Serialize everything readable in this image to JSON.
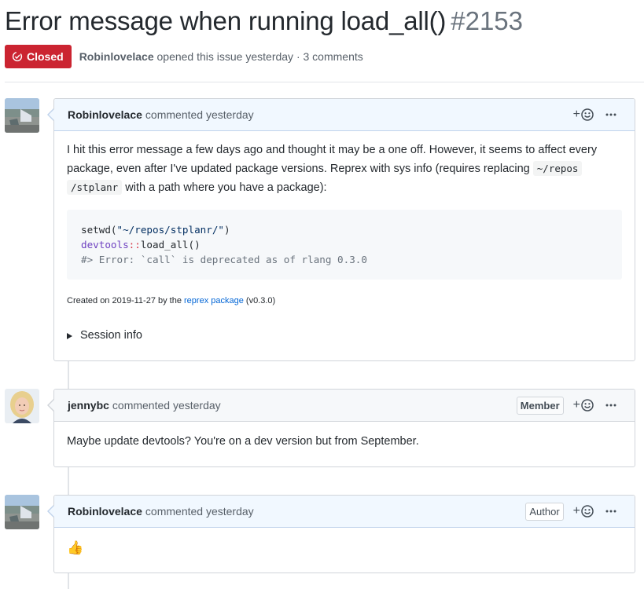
{
  "issue": {
    "title": "Error message when running load_all()",
    "number": "#2153",
    "state": "Closed",
    "opener": "Robinlovelace",
    "opened_text": "opened this issue yesterday · 3 comments"
  },
  "comments": [
    {
      "author": "Robinlovelace",
      "when": "commented yesterday",
      "role": "",
      "body_text_1": "I hit this error message a few days ago and thought it may be a one off. However, it seems to affect every package, even after I've updated package versions. Reprex with sys info (requires replacing ",
      "body_code_1": "~/repos",
      "body_code_2": "/stplanr",
      "body_text_2": " with a path where you have a package):",
      "code_lines": {
        "l1_fn": "setwd(",
        "l1_str": "\"~/repos/stplanr/\"",
        "l1_end": ")",
        "l2_ns": "devtools",
        "l2_op": "::",
        "l2_fn": "load_all()",
        "l3_comment": "#> Error: `call` is deprecated as of rlang 0.3.0"
      },
      "created_prefix": "Created on 2019-11-27 by the ",
      "created_link": "reprex package",
      "created_suffix": " (v0.3.0)",
      "details_summary": "Session info"
    },
    {
      "author": "jennybc",
      "when": "commented yesterday",
      "role": "Member",
      "body": "Maybe update devtools? You're on a dev version but from September."
    },
    {
      "author": "Robinlovelace",
      "when": "commented yesterday",
      "role": "Author",
      "body": "👍"
    }
  ],
  "colors": {
    "closed_red": "#cb2431",
    "header_blue": "#f1f8ff",
    "link_blue": "#0366d6"
  },
  "icons": {
    "state": "issue-closed-icon",
    "reaction": "smiley-icon",
    "more": "kebab-horizontal-icon"
  }
}
